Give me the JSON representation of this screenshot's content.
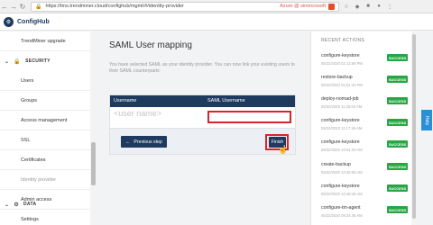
{
  "browser": {
    "url": "https://tms.trendminer.cloud/confighub/mgmt/#/identity-provider",
    "user": "Azure @ sinnicrosoft"
  },
  "app": {
    "name": "ConfigHub"
  },
  "sidebar": {
    "top_item": "TrendMiner upgrade",
    "security_section": "SECURITY",
    "items": [
      {
        "label": "Users"
      },
      {
        "label": "Groups"
      },
      {
        "label": "Access management"
      },
      {
        "label": "SSL"
      },
      {
        "label": "Certificates"
      },
      {
        "label": "Identity provider"
      },
      {
        "label": "Admin access"
      }
    ],
    "data_section": "DATA",
    "bottom_item": "Settings"
  },
  "main": {
    "title": "SAML User mapping",
    "description": "You have selected SAML as your identity provider. You can now link your existing users to their SAML counterparts",
    "table": {
      "col_username": "Username",
      "col_saml": "SAML Username",
      "username_value": "<user name>",
      "saml_value": ""
    },
    "previous_label": "Previous step",
    "finish_label": "Finish"
  },
  "recent_actions": {
    "title": "RECENT ACTIONS",
    "items": [
      {
        "name": "configure-keystore",
        "time": "05/22/2020 02:13:56 PM",
        "status": "SUCCESS"
      },
      {
        "name": "restore-backup",
        "time": "05/22/2020 01:01:43 PM",
        "status": "SUCCESS"
      },
      {
        "name": "deploy-nomad-job",
        "time": "05/22/2020 11:26:03 AM",
        "status": "SUCCESS"
      },
      {
        "name": "configure-keystore",
        "time": "05/22/2020 11:17:36 AM",
        "status": "SUCCESS"
      },
      {
        "name": "configure-keystore",
        "time": "05/22/2020 10:51:32 AM",
        "status": "SUCCESS"
      },
      {
        "name": "create-backup",
        "time": "05/22/2020 10:46:08 AM",
        "status": "SUCCESS"
      },
      {
        "name": "configure-keystore",
        "time": "05/22/2020 10:48:48 AM",
        "status": "SUCCESS"
      },
      {
        "name": "configure-tm-agent",
        "time": "05/22/2020 09:34:45 AM",
        "status": "SUCCESS"
      }
    ]
  },
  "help_tab": "Help",
  "colors": {
    "navy": "#1f3a5f",
    "success": "#27a743",
    "highlight": "#d9252a",
    "help": "#2b8fd6"
  }
}
